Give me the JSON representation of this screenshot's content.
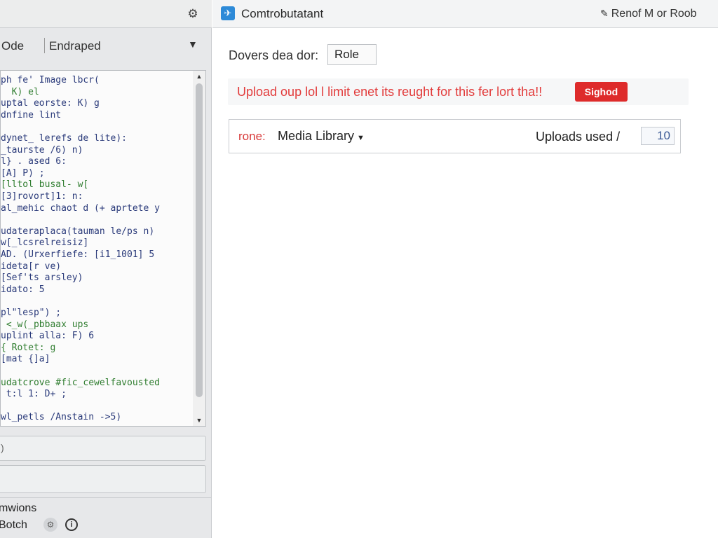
{
  "left_panel": {
    "mode_label": "Ode",
    "mode_value": "Endraped",
    "code_lines": [
      {
        "text": "ph fe' Image lbcr(",
        "color": "blue"
      },
      {
        "text": "  K) el",
        "color": "green"
      },
      {
        "text": "uptal eorste: K) g",
        "color": "blue"
      },
      {
        "text": "dnfine lint",
        "color": "blue"
      },
      {
        "text": "",
        "color": "blue"
      },
      {
        "text": "dynet_ lerefs de lite):",
        "color": "blue"
      },
      {
        "text": "_taurste /6) n)",
        "color": "blue"
      },
      {
        "text": "l} . ased 6:",
        "color": "blue"
      },
      {
        "text": "[A] P) ;",
        "color": "blue"
      },
      {
        "text": "[lltol busal- w[",
        "color": "green"
      },
      {
        "text": "[3]rovort]1: n:",
        "color": "blue"
      },
      {
        "text": "al_mehic chaot d (+ aprtete y",
        "color": "blue"
      },
      {
        "text": "",
        "color": "blue"
      },
      {
        "text": "udateraplaca(tauman le/ps n)",
        "color": "blue"
      },
      {
        "text": "w[_lcsrelreisiz]",
        "color": "blue"
      },
      {
        "text": "AD. (Urxerfiefe: [i1_1001] 5",
        "color": "blue"
      },
      {
        "text": "ideta[r ve)",
        "color": "blue"
      },
      {
        "text": "[Sef'ts arsley)",
        "color": "blue"
      },
      {
        "text": "idato: 5",
        "color": "blue"
      },
      {
        "text": "",
        "color": "blue"
      },
      {
        "text": "pl\"lesp\") ;",
        "color": "blue"
      },
      {
        "text": " <_w(_pbbaax ups",
        "color": "green"
      },
      {
        "text": "uplint alla: F) 6",
        "color": "blue"
      },
      {
        "text": "{ Rotet: g",
        "color": "green"
      },
      {
        "text": "[mat {]a]",
        "color": "blue"
      },
      {
        "text": "",
        "color": "blue"
      },
      {
        "text": "udatcrove #fic_cewelfavousted",
        "color": "green"
      },
      {
        "text": " t:l 1: D+ ;",
        "color": "blue"
      },
      {
        "text": "",
        "color": "blue"
      },
      {
        "text": "wl_petls /Anstain ->5)",
        "color": "blue"
      }
    ],
    "options_label": "mwions",
    "batch_label": "Botch",
    "batch_icon_a": "gear-icon",
    "batch_icon_b": "info-icon"
  },
  "header": {
    "app_title": "Comtrobutatant",
    "user_menu": "Renof M or Roob"
  },
  "role": {
    "label": "Dovers dea dor:",
    "value": "Role"
  },
  "alert": {
    "text": "Upload oup lol l limit enet its reught for this fer lort tha!!",
    "badge": "Sighod",
    "color": "#e23b3b"
  },
  "library": {
    "prefix": "rone:",
    "name": "Media Library",
    "usage_label": "Uploads used /",
    "usage_count": "10"
  },
  "colors": {
    "accent": "#2d8ad8",
    "danger": "#de2b2b",
    "code_blue": "#2a3a7a",
    "code_green": "#2f7d2f"
  }
}
